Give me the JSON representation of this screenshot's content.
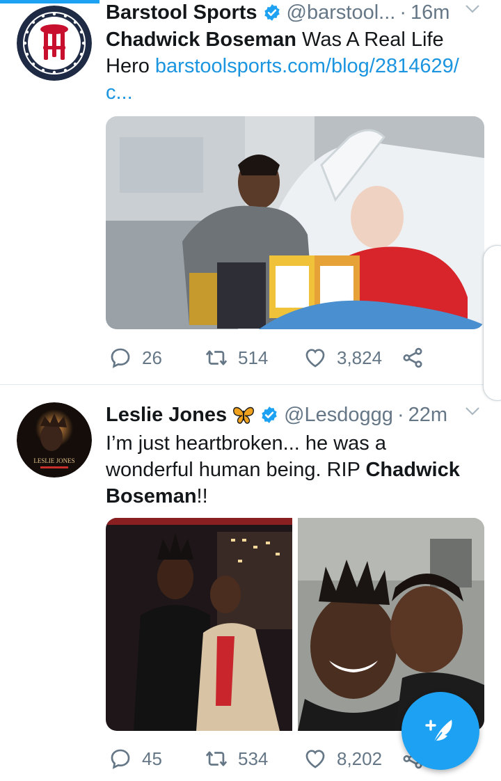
{
  "tweets": [
    {
      "author_name": "Barstool Sports",
      "handle": "@barstool...",
      "separator": "·",
      "time": "16m",
      "text_bold": "Chadwick Boseman",
      "text_plain": " Was A Real Life Hero ",
      "link": "barstoolsports.com/blog/2814629/c...",
      "reply_count": "26",
      "retweet_count": "514",
      "like_count": "3,824"
    },
    {
      "author_name": "Leslie Jones",
      "handle": "@Lesdoggg",
      "separator": "·",
      "time": "22m",
      "text_plain": "I’m just heartbroken... he was a wonderful human being. RIP ",
      "text_bold": "Chadwick Boseman",
      "text_end": "!!",
      "avatar_caption": "LESLIE JONES",
      "reply_count": "45",
      "retweet_count": "534",
      "like_count": "8,202"
    }
  ],
  "icons": {
    "verified": "verified-badge-icon",
    "butterfly": "butterfly-emoji-icon",
    "reply": "reply-icon",
    "retweet": "retweet-icon",
    "like": "heart-icon",
    "share": "share-icon",
    "caret": "chevron-down-icon",
    "compose": "compose-tweet-icon"
  },
  "colors": {
    "accent": "#1da1f2",
    "link": "#1b95e0",
    "secondary_text": "#657786",
    "barstool_navy": "#1f2a44",
    "barstool_red": "#c8102e"
  }
}
